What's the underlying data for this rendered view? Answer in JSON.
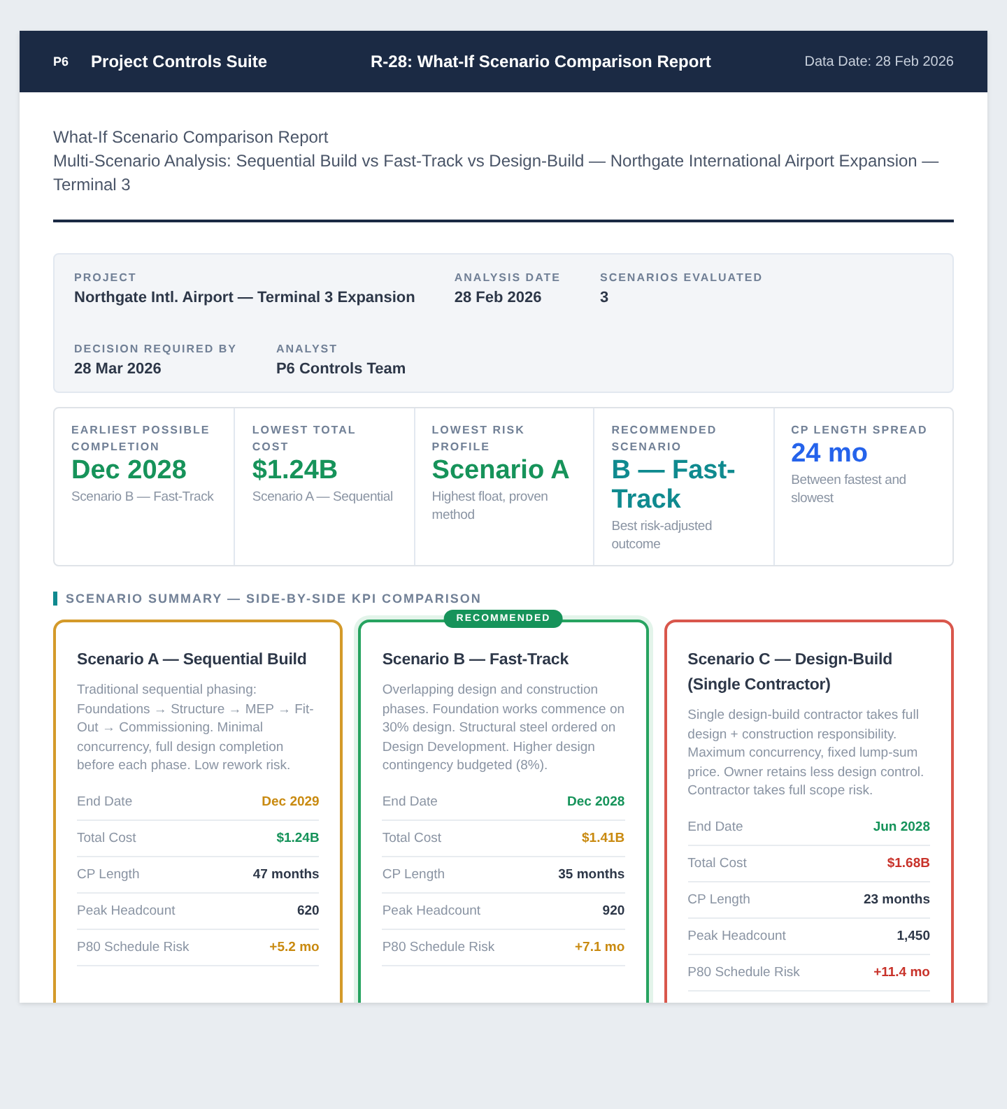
{
  "header": {
    "logo": "P6",
    "app_name": "Project Controls Suite",
    "report_title": "R-28: What-If Scenario Comparison Report",
    "data_date": "Data Date: 28 Feb 2026"
  },
  "intro": {
    "title": "What-If Scenario Comparison Report",
    "subtitle": "Multi-Scenario Analysis: Sequential Build vs Fast-Track vs Design-Build — Northgate International Airport Expansion — Terminal 3"
  },
  "meta": [
    {
      "label": "PROJECT",
      "value": "Northgate Intl. Airport — Terminal 3 Expansion"
    },
    {
      "label": "ANALYSIS DATE",
      "value": "28 Feb 2026"
    },
    {
      "label": "SCENARIOS EVALUATED",
      "value": "3"
    },
    {
      "label": "DECISION REQUIRED BY",
      "value": "28 Mar 2026"
    },
    {
      "label": "ANALYST",
      "value": "P6 Controls Team"
    }
  ],
  "kpis": [
    {
      "label": "EARLIEST POSSIBLE COMPLETION",
      "value": "Dec 2028",
      "note": "Scenario B — Fast-Track",
      "color": "#16935a"
    },
    {
      "label": "LOWEST TOTAL COST",
      "value": "$1.24B",
      "note": "Scenario A — Sequential",
      "color": "#16935a"
    },
    {
      "label": "LOWEST RISK PROFILE",
      "value": "Scenario A",
      "note": "Highest float, proven method",
      "color": "#16935a"
    },
    {
      "label": "RECOMMENDED SCENARIO",
      "value": "B — Fast-Track",
      "note": "Best risk-adjusted outcome",
      "color": "#0f8a8f"
    },
    {
      "label": "CP LENGTH SPREAD",
      "value": "24 mo",
      "note": "Between fastest and slowest",
      "color": "#2563eb"
    }
  ],
  "section_title": "SCENARIO SUMMARY — SIDE-BY-SIDE KPI COMPARISON",
  "scenarios": [
    {
      "title": "Scenario A — Sequential Build",
      "color": "#d49a2a",
      "recommended": false,
      "description": "Traditional sequential phasing: Foundations → Structure → MEP → Fit-Out → Commissioning. Minimal concurrency, full design completion before each phase. Low rework risk.",
      "metrics": [
        {
          "label": "End Date",
          "value": "Dec 2029",
          "color": "#c98a10"
        },
        {
          "label": "Total Cost",
          "value": "$1.24B",
          "color": "#16935a"
        },
        {
          "label": "CP Length",
          "value": "47 months",
          "color": "#2d3748"
        },
        {
          "label": "Peak Headcount",
          "value": "620",
          "color": "#2d3748"
        },
        {
          "label": "P80 Schedule Risk",
          "value": "+5.2 mo",
          "color": "#c98a10"
        }
      ]
    },
    {
      "title": "Scenario B — Fast-Track",
      "color": "#27a360",
      "recommended": true,
      "badge": "RECOMMENDED",
      "description": "Overlapping design and construction phases. Foundation works commence on 30% design. Structural steel ordered on Design Development. Higher design contingency budgeted (8%).",
      "metrics": [
        {
          "label": "End Date",
          "value": "Dec 2028",
          "color": "#16935a"
        },
        {
          "label": "Total Cost",
          "value": "$1.41B",
          "color": "#c98a10"
        },
        {
          "label": "CP Length",
          "value": "35 months",
          "color": "#2d3748"
        },
        {
          "label": "Peak Headcount",
          "value": "920",
          "color": "#2d3748"
        },
        {
          "label": "P80 Schedule Risk",
          "value": "+7.1 mo",
          "color": "#c98a10"
        }
      ]
    },
    {
      "title": "Scenario C — Design-Build (Single Contractor)",
      "color": "#d9574c",
      "recommended": false,
      "description": "Single design-build contractor takes full design + construction responsibility. Maximum concurrency, fixed lump-sum price. Owner retains less design control. Contractor takes full scope risk.",
      "metrics": [
        {
          "label": "End Date",
          "value": "Jun 2028",
          "color": "#16935a"
        },
        {
          "label": "Total Cost",
          "value": "$1.68B",
          "color": "#c8322a"
        },
        {
          "label": "CP Length",
          "value": "23 months",
          "color": "#2d3748"
        },
        {
          "label": "Peak Headcount",
          "value": "1,450",
          "color": "#2d3748"
        },
        {
          "label": "P80 Schedule Risk",
          "value": "+11.4 mo",
          "color": "#c8322a"
        }
      ]
    }
  ]
}
